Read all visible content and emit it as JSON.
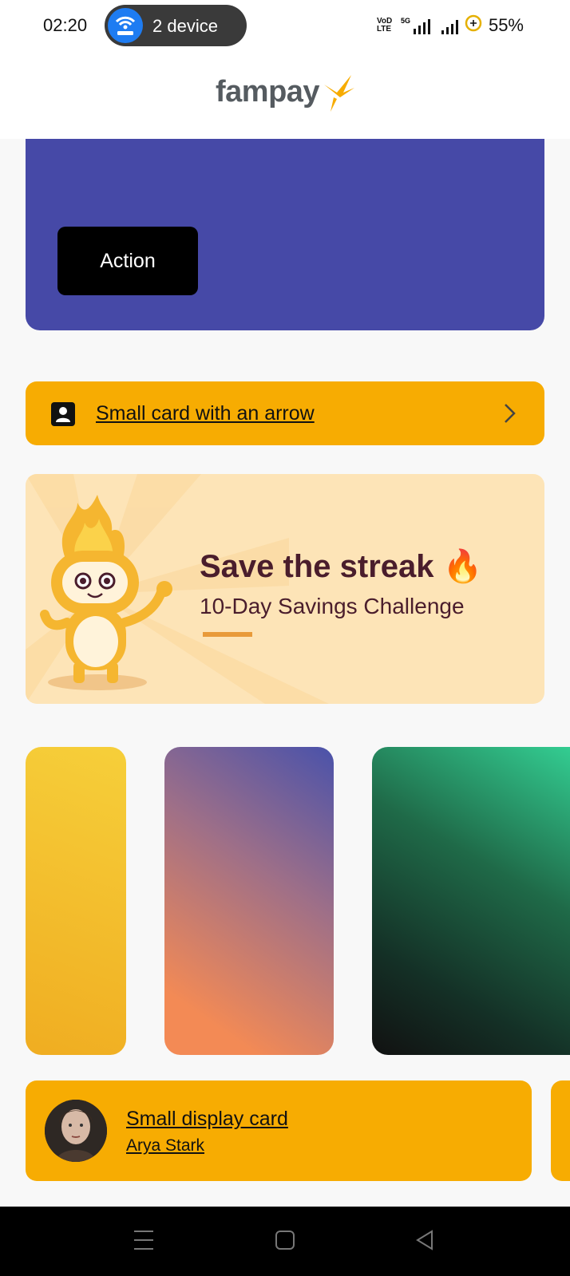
{
  "status_bar": {
    "time": "02:20",
    "hotspot_label": "2 device",
    "network_label_top": "VoD",
    "network_label_bottom": "LTE",
    "network_type": "5G",
    "battery_percent": "55%"
  },
  "app_bar": {
    "brand": "fampay"
  },
  "big_card": {
    "action_label": "Action",
    "background": "#4649a7"
  },
  "arrow_card": {
    "title": "Small card with an arrow",
    "background": "#f7ac02"
  },
  "banner": {
    "title": "Save the streak 🔥",
    "subtitle": "10-Day Savings Challenge"
  },
  "display_card": {
    "title": "Small display card",
    "subtitle": "Arya Stark"
  },
  "icons": [
    "wifi-hotspot-icon",
    "signal-icon",
    "battery-icon",
    "fampay-logo-icon",
    "person-icon",
    "chevron-right-icon",
    "mascot-icon",
    "avatar",
    "menu-icon",
    "home-icon",
    "back-icon"
  ]
}
